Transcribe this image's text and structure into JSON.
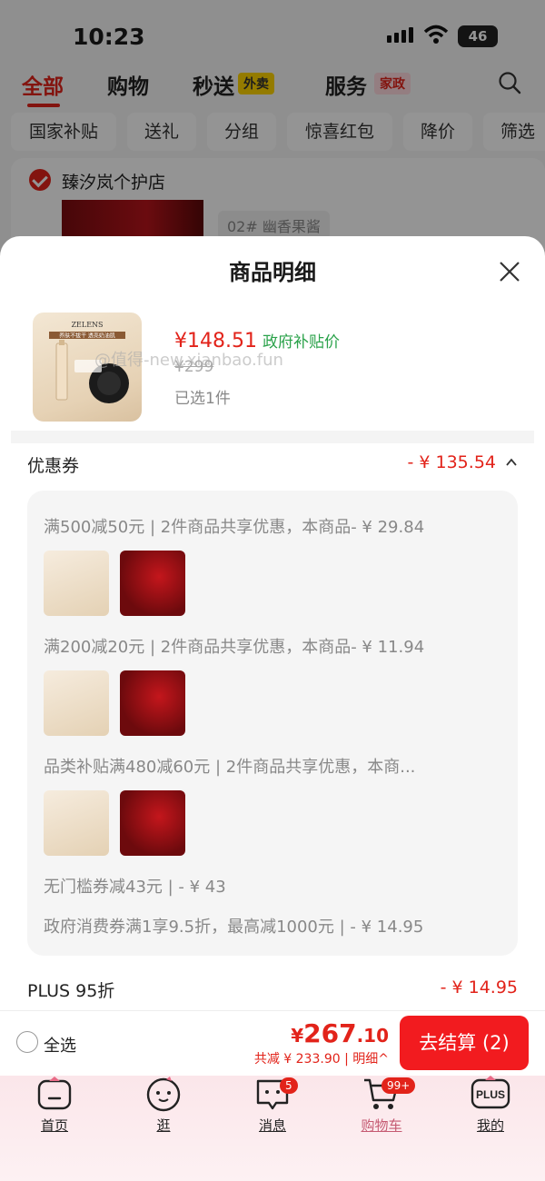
{
  "status_bar": {
    "time": "10:23",
    "battery": "46"
  },
  "top_tabs": [
    {
      "label": "全部",
      "active": true
    },
    {
      "label": "购物",
      "active": false
    },
    {
      "label": "秒送",
      "active": false,
      "tag": "外卖"
    },
    {
      "label": "服务",
      "active": false,
      "tag": "家政"
    }
  ],
  "filters": [
    "国家补贴",
    "送礼",
    "分组",
    "惊喜红包",
    "降价",
    "筛选"
  ],
  "background_shop": {
    "name": "臻汐岚个护店",
    "variant": "02# 幽香果酱"
  },
  "sheet": {
    "title": "商品明细",
    "product": {
      "price": "¥148.51",
      "price_tag": "政府补贴价",
      "original_price": "¥299",
      "selected": "已选1件",
      "image_brand": "ZELENS",
      "image_slogan": "养肤不拔干 透亮奶油肌"
    },
    "watermark": "@值得-new.xianbao.fun",
    "coupon": {
      "label": "优惠券",
      "total": "- ¥ 135.54",
      "lines": [
        "满500减50元 | 2件商品共享优惠，本商品- ¥ 29.84",
        "满200减20元 | 2件商品共享优惠，本商品- ¥ 11.94",
        "品类补贴满480减60元 | 2件商品共享优惠，本商...",
        "无门槛券减43元 | - ¥ 43",
        "政府消费券满1享9.5折，最高减1000元 | - ¥ 14.95"
      ]
    },
    "plus": {
      "label": "PLUS 95折",
      "amount": "- ¥ 14.95"
    }
  },
  "checkout": {
    "select_all": "全选",
    "price_symbol": "¥",
    "price_int": "267",
    "price_dec": ".10",
    "discount_line": "共减 ¥ 233.90 | 明细^",
    "button": "去结算 (2)"
  },
  "tabbar": {
    "items": [
      {
        "label": "首页",
        "icon": "home-icon"
      },
      {
        "label": "逛",
        "icon": "face-icon"
      },
      {
        "label": "消息",
        "icon": "message-icon",
        "badge": "5"
      },
      {
        "label": "购物车",
        "icon": "cart-icon",
        "badge": "99+",
        "active": true
      },
      {
        "label": "我的",
        "icon": "plus-member-icon",
        "icon_text": "PLUS"
      }
    ]
  },
  "colors": {
    "accent": "#e2231a",
    "green": "#2aa24a",
    "tag_yellow": "#ffd400"
  }
}
